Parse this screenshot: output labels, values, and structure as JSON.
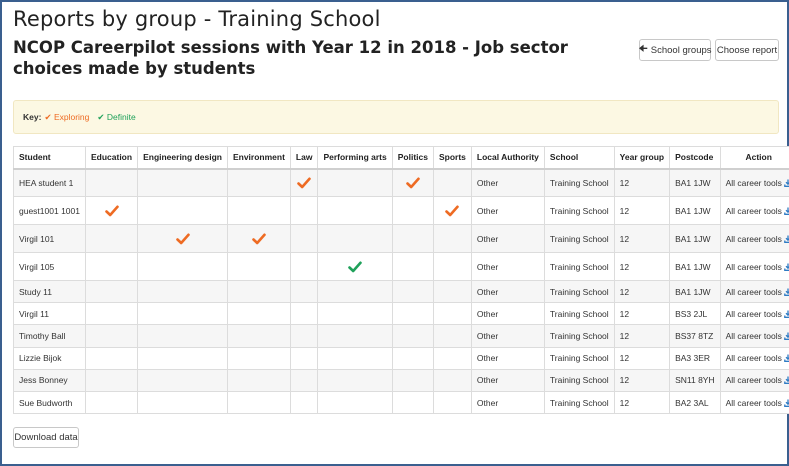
{
  "page": {
    "title": "Reports by group - Training School",
    "report_title": "NCOP Careerpilot sessions with Year 12 in 2018 - Job sector choices made by students"
  },
  "toolbar": {
    "school_groups_label": "School groups",
    "choose_report_label": "Choose report"
  },
  "key": {
    "label": "Key:",
    "exploring": "Exploring",
    "definite": "Definite"
  },
  "colors": {
    "exploring": "#ee6b23",
    "definite": "#1fa15a",
    "link": "#2e7bc4"
  },
  "icons": {
    "exploring": "check-icon",
    "definite": "check-icon",
    "download": "download-icon",
    "back": "arrow-left-icon"
  },
  "table": {
    "columns": [
      "Student",
      "Education",
      "Engineering design",
      "Environment",
      "Law",
      "Performing arts",
      "Politics",
      "Sports",
      "Local Authority",
      "School",
      "Year group",
      "Postcode",
      "Action"
    ],
    "rows": [
      {
        "student": "HEA student 1",
        "ticks": {
          "law": "exploring",
          "politics": "exploring"
        },
        "local_authority": "Other",
        "school": "Training School",
        "year_group": "12",
        "postcode": "BA1 1JW",
        "action": "All career tools"
      },
      {
        "student": "guest1001 1001",
        "ticks": {
          "education": "exploring",
          "sports": "exploring"
        },
        "local_authority": "Other",
        "school": "Training School",
        "year_group": "12",
        "postcode": "BA1 1JW",
        "action": "All career tools"
      },
      {
        "student": "Virgil 101",
        "ticks": {
          "engineering_design": "exploring",
          "environment": "exploring"
        },
        "local_authority": "Other",
        "school": "Training School",
        "year_group": "12",
        "postcode": "BA1 1JW",
        "action": "All career tools"
      },
      {
        "student": "Virgil 105",
        "ticks": {
          "performing_arts": "definite"
        },
        "local_authority": "Other",
        "school": "Training School",
        "year_group": "12",
        "postcode": "BA1 1JW",
        "action": "All career tools"
      },
      {
        "student": "Study 11",
        "ticks": {},
        "local_authority": "Other",
        "school": "Training School",
        "year_group": "12",
        "postcode": "BA1 1JW",
        "action": "All career tools"
      },
      {
        "student": "Virgil 11",
        "ticks": {},
        "local_authority": "Other",
        "school": "Training School",
        "year_group": "12",
        "postcode": "BS3 2JL",
        "action": "All career tools"
      },
      {
        "student": "Timothy Ball",
        "ticks": {},
        "local_authority": "Other",
        "school": "Training School",
        "year_group": "12",
        "postcode": "BS37 8TZ",
        "action": "All career tools"
      },
      {
        "student": "Lizzie Bijok",
        "ticks": {},
        "local_authority": "Other",
        "school": "Training School",
        "year_group": "12",
        "postcode": "BA3 3ER",
        "action": "All career tools"
      },
      {
        "student": "Jess Bonney",
        "ticks": {},
        "local_authority": "Other",
        "school": "Training School",
        "year_group": "12",
        "postcode": "SN11 8YH",
        "action": "All career tools"
      },
      {
        "student": "Sue Budworth",
        "ticks": {},
        "local_authority": "Other",
        "school": "Training School",
        "year_group": "12",
        "postcode": "BA2 3AL",
        "action": "All career tools"
      }
    ]
  },
  "footer": {
    "download_label": "Download data"
  }
}
